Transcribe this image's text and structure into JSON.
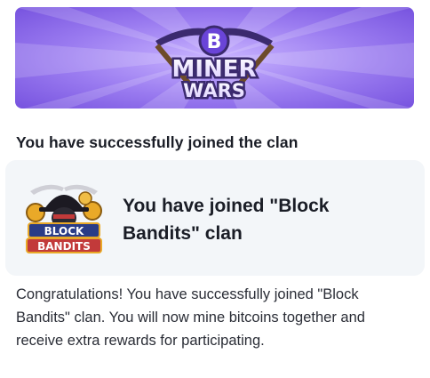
{
  "banner": {
    "logo_line1": "MINER",
    "logo_line2": "WARS",
    "logo_symbol": "bitcoin-icon",
    "colors": {
      "bg_light": "#a98cf2",
      "bg_dark": "#7753df",
      "accent": "#6a44d8"
    }
  },
  "heading": "You have successfully joined the clan",
  "card": {
    "title": "You have joined \"Block Bandits\" clan",
    "clan_logo": {
      "line1": "BLOCK",
      "line2": "BANDITS",
      "colors": {
        "gold": "#e9a928",
        "dark": "#1c1a22",
        "red": "#c23a3a",
        "blue": "#2a3c86"
      }
    },
    "background": "#f3f6f9"
  },
  "message": "Congratulations! You have successfully joined \"Block Bandits\" clan. You will now mine bitcoins together and receive extra rewards for participating."
}
